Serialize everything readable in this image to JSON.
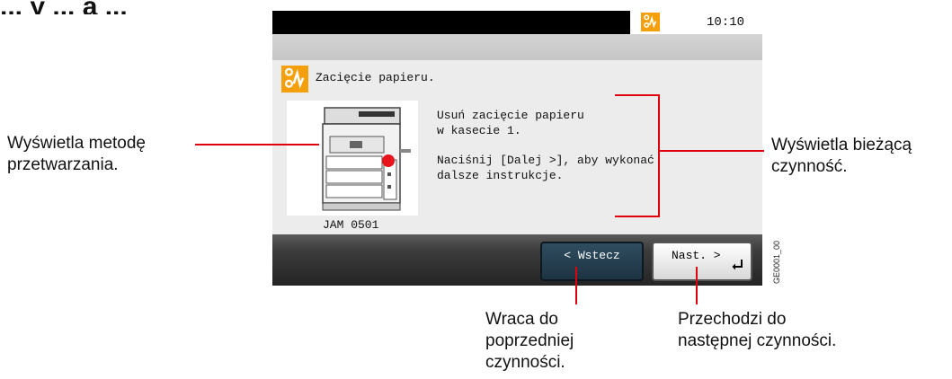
{
  "page": {
    "heading_partial": "... y ... a ..."
  },
  "screen": {
    "clock": "10:10",
    "status_icon": "jam-alert-icon",
    "message_title": "Zacięcie papieru.",
    "printer_image": "printer-jam-illustration",
    "jam_code": "JAM 0501",
    "instruction_lines": [
      "Usuń zacięcie papieru",
      "w kasecie 1."
    ],
    "instruction_lines_2": [
      "Naciśnij [Dalej >], aby wykonać",
      "dalsze instrukcje."
    ],
    "back_button": "< Wstecz",
    "next_button": "Nast. >",
    "enter_icon": "enter-arrow-icon"
  },
  "callouts": {
    "left": [
      "Wyświetla metodę",
      "przetwarzania."
    ],
    "right": [
      "Wyświetla bieżącą",
      "czynność."
    ],
    "back": [
      "Wraca do",
      "poprzedniej",
      "czynności."
    ],
    "next": [
      "Przechodzi do",
      "następnej czynności."
    ]
  },
  "figure_code": "GE0001_00",
  "colors": {
    "accent_orange": "#f5a00b",
    "callout_red": "#e0000d",
    "jam_red": "#e8141c"
  }
}
